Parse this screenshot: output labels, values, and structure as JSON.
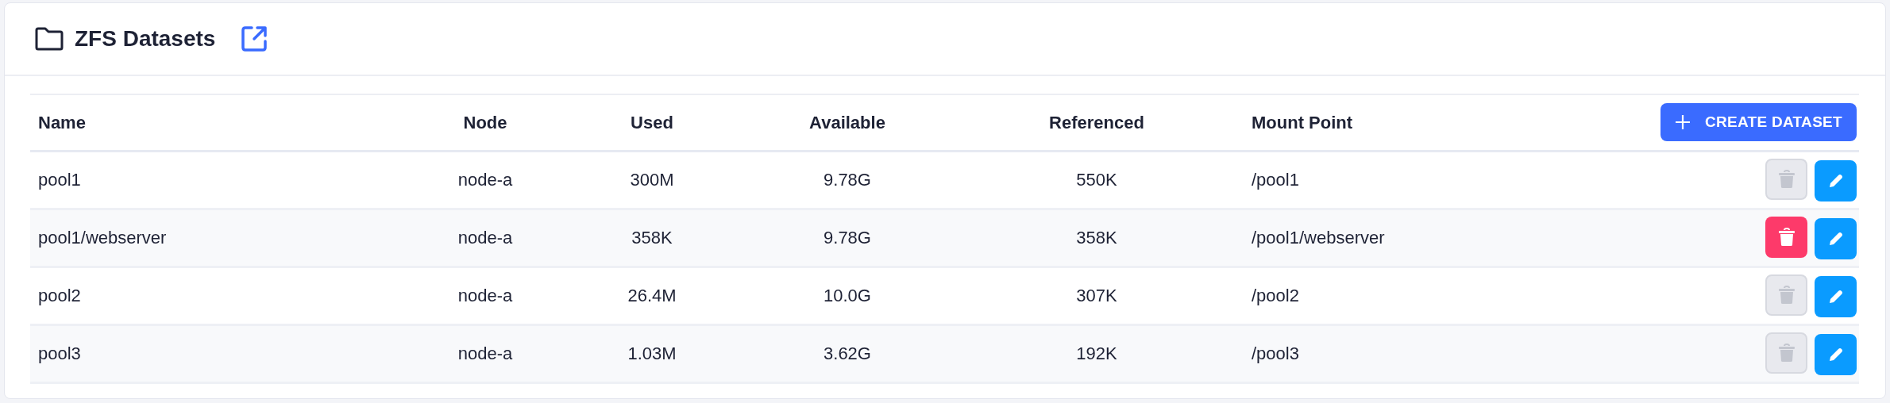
{
  "title": "ZFS Datasets",
  "table": {
    "columns": [
      "Name",
      "Node",
      "Used",
      "Available",
      "Referenced",
      "Mount Point"
    ],
    "create_button": "CREATE DATASET",
    "rows": [
      {
        "name": "pool1",
        "node": "node-a",
        "used": "300M",
        "available": "9.78G",
        "referenced": "550K",
        "mount_point": "/pool1",
        "delete_disabled": true
      },
      {
        "name": "pool1/webserver",
        "node": "node-a",
        "used": "358K",
        "available": "9.78G",
        "referenced": "358K",
        "mount_point": "/pool1/webserver",
        "delete_disabled": false
      },
      {
        "name": "pool2",
        "node": "node-a",
        "used": "26.4M",
        "available": "10.0G",
        "referenced": "307K",
        "mount_point": "/pool2",
        "delete_disabled": true
      },
      {
        "name": "pool3",
        "node": "node-a",
        "used": "1.03M",
        "available": "3.62G",
        "referenced": "192K",
        "mount_point": "/pool3",
        "delete_disabled": true
      }
    ]
  }
}
